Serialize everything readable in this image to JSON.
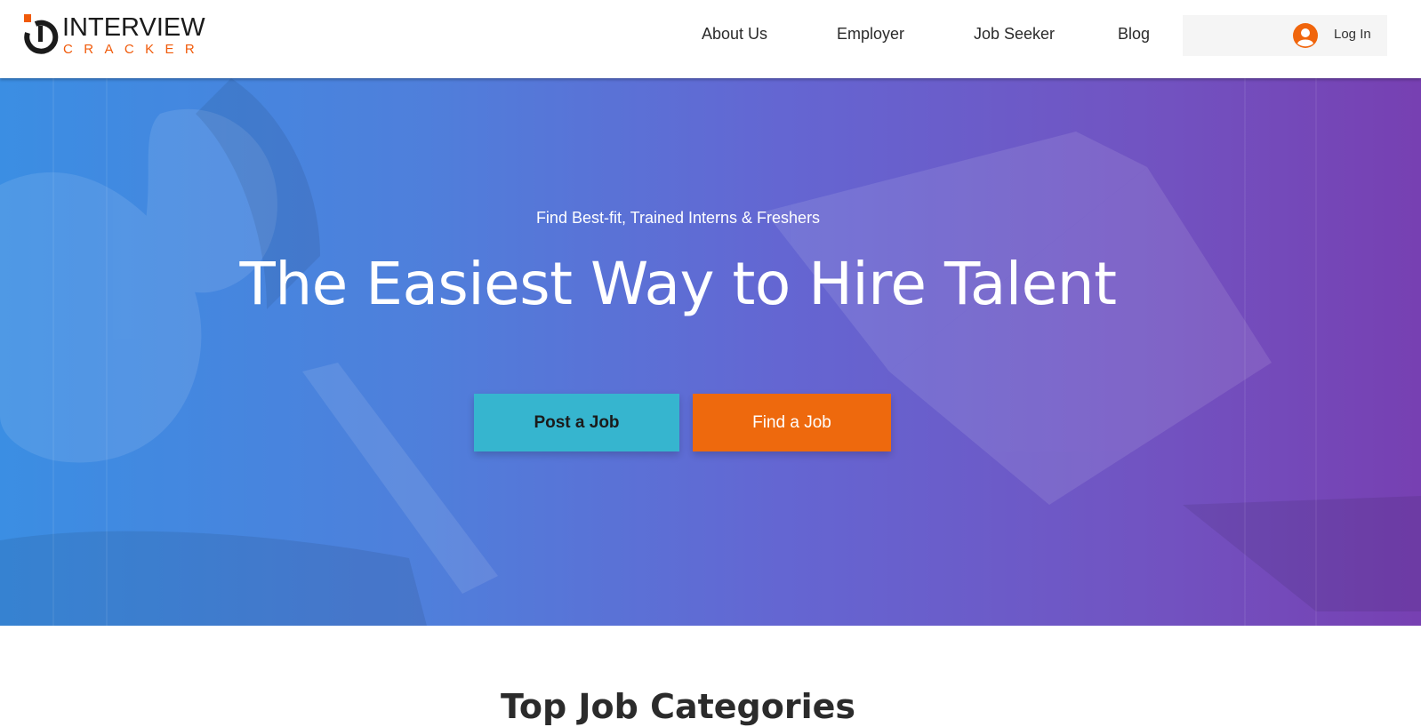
{
  "brand": {
    "name_line1": "INTERVIEW",
    "name_line2": "CRACKER",
    "accent_color": "#f05a0a",
    "logo_icon": "interview-cracker-logo-icon"
  },
  "nav": {
    "items": [
      {
        "label": "About Us"
      },
      {
        "label": "Employer"
      },
      {
        "label": "Job Seeker"
      },
      {
        "label": "Blog"
      }
    ],
    "login_label": "Log In",
    "login_icon": "user-avatar-icon",
    "login_icon_color": "#f0650c"
  },
  "hero": {
    "kicker": "Find Best-fit, Trained Interns & Freshers",
    "title": "The Easiest Way to Hire Talent",
    "buttons": {
      "post_job": "Post a Job",
      "find_job": "Find a Job"
    },
    "colors": {
      "gradient_start": "#3b8ee3",
      "gradient_end": "#7740b2",
      "post_button": "#36b5cf",
      "find_button": "#ee690d"
    }
  },
  "section": {
    "title": "Top Job Categories"
  }
}
